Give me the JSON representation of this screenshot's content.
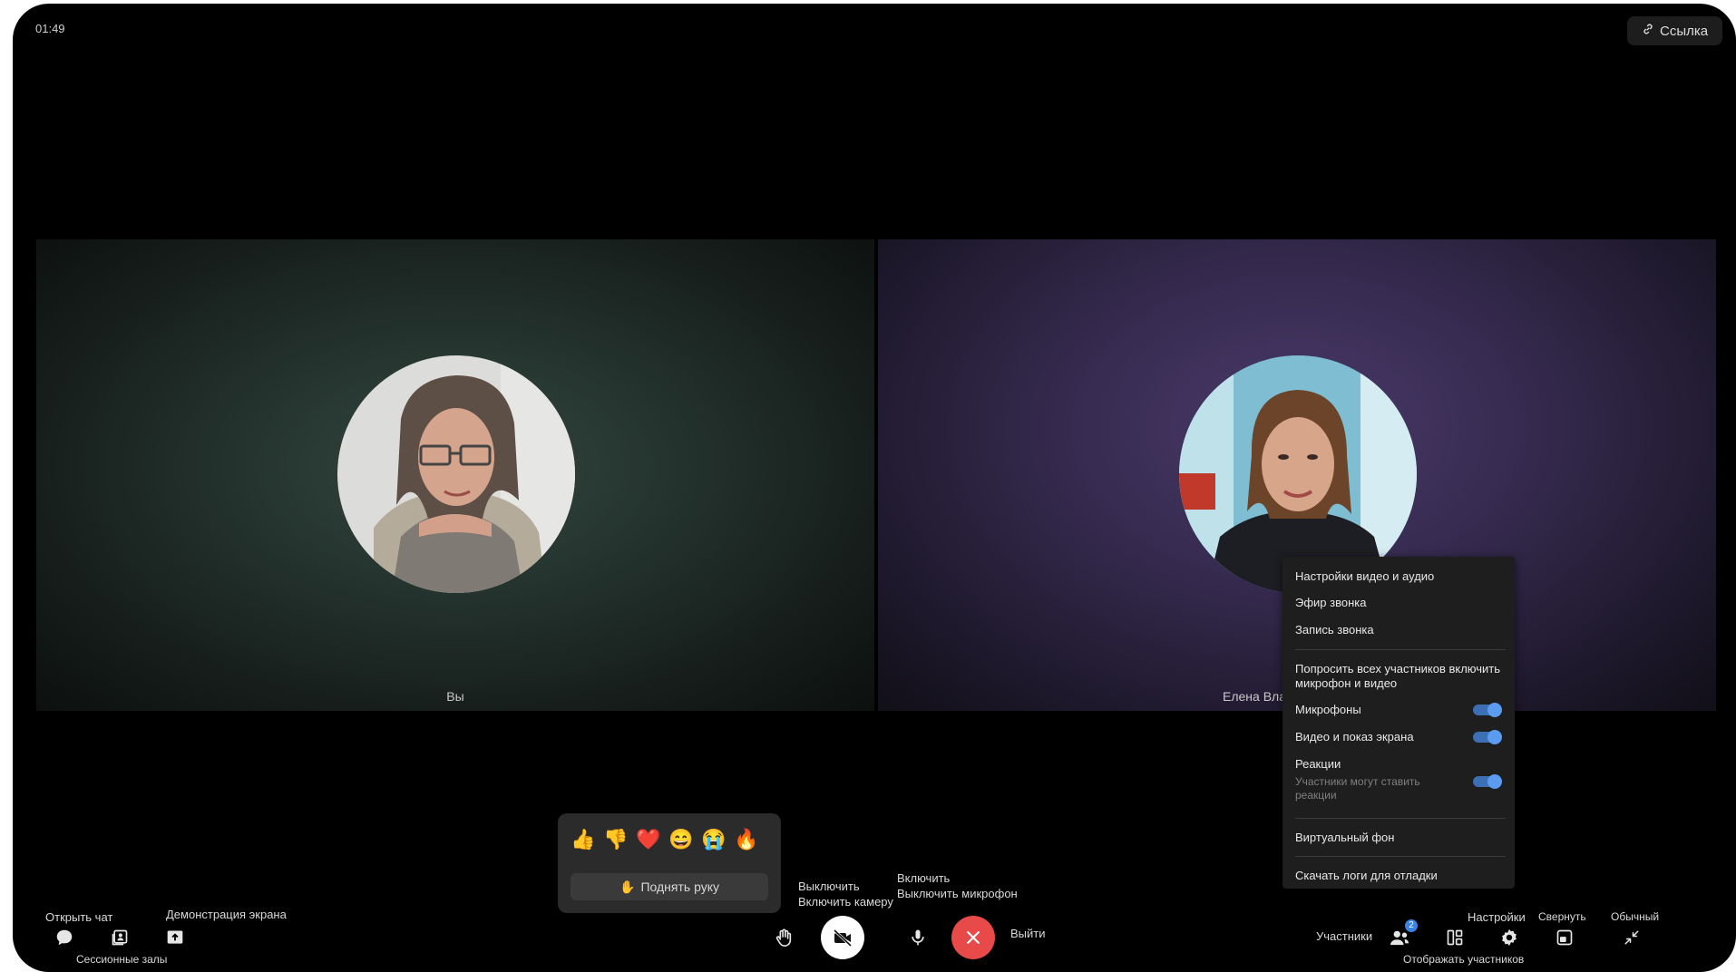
{
  "header": {
    "timer": "01:49",
    "link_label": "Ссылка"
  },
  "tiles": [
    {
      "name": "Вы"
    },
    {
      "name": "Елена Влади"
    }
  ],
  "menu": {
    "items": [
      "Настройки видео и аудио",
      "Эфир звонка",
      "Запись звонка"
    ],
    "ask_all": "Попросить всех участников включить микрофон и видео",
    "toggles": {
      "microphones": "Микрофоны",
      "video": "Видео и показ экрана",
      "reactions": "Реакции",
      "reactions_sub": "Участники могут ставить реакции"
    },
    "virtual_bg": "Виртуальный фон",
    "download_logs": "Скачать логи для отладки"
  },
  "reactions": {
    "emojis": [
      "👍",
      "👎",
      "❤️",
      "😄",
      "😭",
      "🔥"
    ],
    "raise_hand": "Поднять руку"
  },
  "toolbar": {
    "open_chat": "Открыть чат",
    "screen_demo": "Демонстрация экрана",
    "session_rooms": "Сессионные залы",
    "camera_off": "Выключить",
    "camera_on": "Включить камеру",
    "mic_on": "Включить",
    "mic_off": "Выключить микрофон",
    "leave": "Выйти",
    "participants": "Участники",
    "participants_count": "2",
    "settings": "Настройки",
    "minimize": "Свернуть",
    "normal": "Обычный",
    "show_participants": "Отображать участников"
  },
  "colors": {
    "end_call": "#e84949",
    "toggle_on": "#5b9cf0",
    "badge": "#3b82e6"
  }
}
